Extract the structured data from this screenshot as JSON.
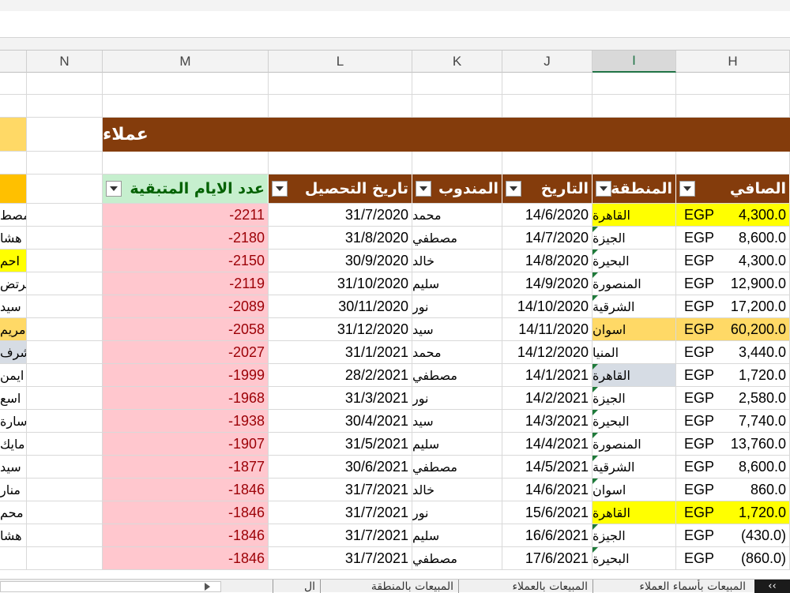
{
  "columns": {
    "N": "N",
    "M": "M",
    "L": "L",
    "K": "K",
    "J": "J",
    "I": "I",
    "H": "H"
  },
  "title": "عملاء",
  "headers": {
    "days": "عدد الايام المتبقية",
    "collect": "تاريخ التحصيل",
    "rep": "المندوب",
    "date": "التاريخ",
    "region": "المنطقة",
    "net": "الصافي"
  },
  "currency": "EGP",
  "rows": [
    {
      "days": "-2211",
      "collect": "31/7/2020",
      "rep": "محمد",
      "date": "14/6/2020",
      "region": "القاهرة",
      "net": "4,300.0",
      "cust": "مصط"
    },
    {
      "days": "-2180",
      "collect": "31/8/2020",
      "rep": "مصطفي",
      "date": "14/7/2020",
      "region": "الجيزة",
      "net": "8,600.0",
      "cust": "هشا"
    },
    {
      "days": "-2150",
      "collect": "30/9/2020",
      "rep": "خالد",
      "date": "14/8/2020",
      "region": "البحيرة",
      "net": "4,300.0",
      "cust": "احم"
    },
    {
      "days": "-2119",
      "collect": "31/10/2020",
      "rep": "سليم",
      "date": "14/9/2020",
      "region": "المنصورة",
      "net": "12,900.0",
      "cust": "مرتض"
    },
    {
      "days": "-2089",
      "collect": "30/11/2020",
      "rep": "نور",
      "date": "14/10/2020",
      "region": "الشرقية",
      "net": "17,200.0",
      "cust": "سيد"
    },
    {
      "days": "-2058",
      "collect": "31/12/2020",
      "rep": "سيد",
      "date": "14/11/2020",
      "region": "اسوان",
      "net": "60,200.0",
      "cust": "مريم"
    },
    {
      "days": "-2027",
      "collect": "31/1/2021",
      "rep": "محمد",
      "date": "14/12/2020",
      "region": "المنيا",
      "net": "3,440.0",
      "cust": "اشرف"
    },
    {
      "days": "-1999",
      "collect": "28/2/2021",
      "rep": "مصطفي",
      "date": "14/1/2021",
      "region": "القاهرة",
      "net": "1,720.0",
      "cust": "ايمن"
    },
    {
      "days": "-1968",
      "collect": "31/3/2021",
      "rep": "نور",
      "date": "14/2/2021",
      "region": "الجيزة",
      "net": "2,580.0",
      "cust": "اسع"
    },
    {
      "days": "-1938",
      "collect": "30/4/2021",
      "rep": "سيد",
      "date": "14/3/2021",
      "region": "البحيرة",
      "net": "7,740.0",
      "cust": "سارة"
    },
    {
      "days": "-1907",
      "collect": "31/5/2021",
      "rep": "سليم",
      "date": "14/4/2021",
      "region": "المنصورة",
      "net": "13,760.0",
      "cust": "مايك"
    },
    {
      "days": "-1877",
      "collect": "30/6/2021",
      "rep": "مصطفي",
      "date": "14/5/2021",
      "region": "الشرقية",
      "net": "8,600.0",
      "cust": "سيد"
    },
    {
      "days": "-1846",
      "collect": "31/7/2021",
      "rep": "خالد",
      "date": "14/6/2021",
      "region": "اسوان",
      "net": "860.0",
      "cust": "منار"
    },
    {
      "days": "-1846",
      "collect": "31/7/2021",
      "rep": "نور",
      "date": "15/6/2021",
      "region": "القاهرة",
      "net": "1,720.0",
      "cust": "محم"
    },
    {
      "days": "-1846",
      "collect": "31/7/2021",
      "rep": "سليم",
      "date": "16/6/2021",
      "region": "الجيزة",
      "net": "(430.0)",
      "cust": "هشا"
    },
    {
      "days": "-1846",
      "collect": "31/7/2021",
      "rep": "مصطفي",
      "date": "17/6/2021",
      "region": "البحيرة",
      "net": "(860.0)",
      "cust": ""
    }
  ],
  "tabs": [
    "المبيعات بأسماء العملاء",
    "المبيعات بالعملاء",
    "المبيعات بالمنطقة",
    "ال"
  ],
  "colors": {
    "header": "#843c0c",
    "yellow": "#ffff00",
    "orange": "#ffd966",
    "blueGray": "#d6dce4",
    "red": "#ffc7ce",
    "redText": "#9c0006",
    "green": "#c6efce"
  }
}
